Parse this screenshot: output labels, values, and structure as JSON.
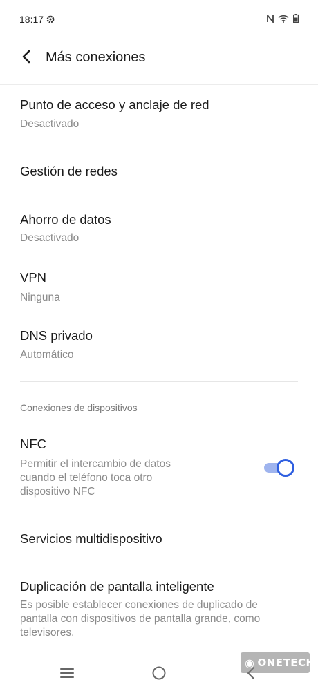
{
  "status": {
    "time": "18:17",
    "icons": [
      "settings-icon",
      "nfc-icon",
      "wifi-icon",
      "battery-icon"
    ]
  },
  "header": {
    "back_icon": "chevron-left-icon",
    "title": "Más conexiones"
  },
  "items": [
    {
      "title": "Punto de acceso y anclaje de red",
      "subtitle": "Desactivado"
    },
    {
      "title": "Gestión de redes"
    },
    {
      "title": "Ahorro de datos",
      "subtitle": "Desactivado"
    },
    {
      "title": "VPN",
      "subtitle": "Ninguna"
    },
    {
      "title": "DNS privado",
      "subtitle": "Automático"
    }
  ],
  "section": {
    "header": "Conexiones de dispositivos",
    "nfc": {
      "title": "NFC",
      "description": "Permitir el intercambio de datos cuando el teléfono toca otro dispositivo NFC",
      "enabled": true
    },
    "multi": {
      "title": "Servicios multidispositivo"
    },
    "mirror": {
      "title": "Duplicación de pantalla inteligente",
      "description": "Es posible establecer conexiones de duplicado de pantalla con dispositivos de pantalla grande, como televisores."
    }
  },
  "navigation": {
    "icons": [
      "menu-icon",
      "home-icon",
      "back-icon"
    ]
  },
  "watermark": "ONETECH",
  "colors": {
    "accent": "#2f5fe0",
    "track": "#9fb4ee",
    "secondary_text": "#8a8a8a"
  }
}
